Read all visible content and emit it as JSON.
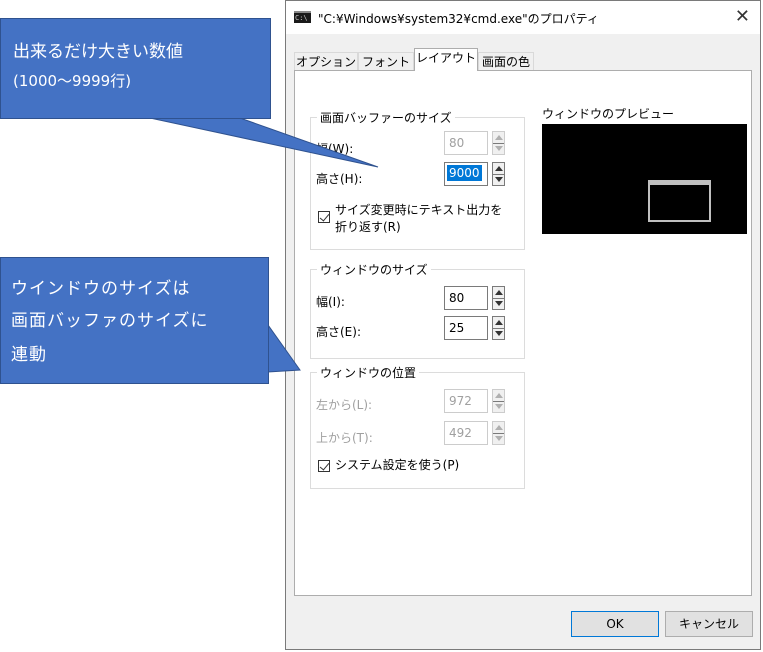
{
  "window": {
    "title": "\"C:¥Windows¥system32¥cmd.exe\"のプロパティ",
    "close": "✕",
    "icon_text": "C:\\"
  },
  "tabs": [
    {
      "label": "オプション",
      "active": false
    },
    {
      "label": "フォント",
      "active": false
    },
    {
      "label": "レイアウト",
      "active": true
    },
    {
      "label": "画面の色",
      "active": false
    }
  ],
  "buffer_group": {
    "label": "画面バッファーのサイズ",
    "width_label": "幅(W):",
    "width_value": "80",
    "height_label": "高さ(H):",
    "height_value": "9000",
    "wrap_label": "サイズ変更時にテキスト出力を\n折り返す(R)",
    "wrap_checked": true
  },
  "window_size_group": {
    "label": "ウィンドウのサイズ",
    "width_label": "幅(I):",
    "width_value": "80",
    "height_label": "高さ(E):",
    "height_value": "25"
  },
  "window_pos_group": {
    "label": "ウィンドウの位置",
    "left_label": "左から(L):",
    "left_value": "972",
    "top_label": "上から(T):",
    "top_value": "492",
    "system_label": "システム設定を使う(P)",
    "system_checked": true
  },
  "preview_label": "ウィンドウのプレビュー",
  "buttons": {
    "ok": "OK",
    "cancel": "キャンセル"
  },
  "callouts": {
    "top_line1": "出来るだけ大きい数値",
    "top_line2": "(1000〜9999行)",
    "bottom_line1": "ウインドウのサイズは",
    "bottom_line2": "画面バッファのサイズに",
    "bottom_line3": "連動"
  },
  "colors": {
    "callout": "#4472c4",
    "selection": "#0078d7"
  }
}
